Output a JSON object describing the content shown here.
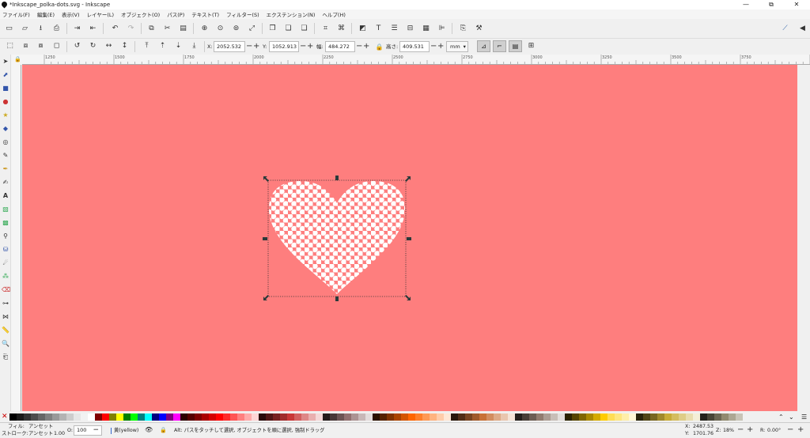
{
  "window": {
    "title": "*Inkscape_polka-dots.svg - Inkscape",
    "minimize": "—",
    "maximize": "⧉",
    "close": "✕"
  },
  "menu": [
    "ファイル(F)",
    "編集(E)",
    "表示(V)",
    "レイヤー(L)",
    "オブジェクト(O)",
    "パス(P)",
    "テキスト(T)",
    "フィルター(S)",
    "エクステンション(N)",
    "ヘルプ(H)"
  ],
  "selector_toolbar": {
    "x_label": "X:",
    "x_value": "2052.532",
    "y_label": "Y:",
    "y_value": "1052.913",
    "w_label": "幅:",
    "w_value": "484.272",
    "h_label": "高さ:",
    "h_value": "409.531",
    "unit": "mm"
  },
  "ruler": {
    "labels": [
      "1250",
      "1500",
      "1750",
      "2000",
      "2250",
      "2500",
      "2750",
      "3000",
      "3250",
      "3500",
      "3750"
    ]
  },
  "status": {
    "fill_label": "フィル:",
    "fill_value": "アンセット",
    "stroke_label": "ストローク:",
    "stroke_value": "アンセット",
    "stroke_width": "1.00",
    "opacity_label": "O:",
    "opacity_value": "100",
    "layer": "黄(yellow)",
    "message": "Alt: パスをタッチして選択, オブジェクトを順に選択, 強制ドラッグ",
    "x_label": "X:",
    "x_value": "2487.53",
    "y_label": "Y:",
    "y_value": "1701.76",
    "zoom_label": "Z:",
    "zoom_value": "18%",
    "rotate_label": "R:",
    "rotate_value": "0.00°"
  },
  "colors": {
    "canvas": "#fe7e7e",
    "heart_fill": "#ffffff"
  },
  "palette_colors": [
    "#000000",
    "#1a1a1a",
    "#333333",
    "#4d4d4d",
    "#666666",
    "#808080",
    "#999999",
    "#b3b3b3",
    "#cccccc",
    "#e6e6e6",
    "#f2f2f2",
    "#ffffff",
    "#800000",
    "#ff0000",
    "#808000",
    "#ffff00",
    "#008000",
    "#00ff00",
    "#008080",
    "#00ffff",
    "#000080",
    "#0000ff",
    "#800080",
    "#ff00ff",
    "#2b0000",
    "#550000",
    "#800000",
    "#aa0000",
    "#d40000",
    "#ff0000",
    "#ff2a2a",
    "#ff5555",
    "#ff8080",
    "#ffaaaa",
    "#ffd5d5",
    "#280b0b",
    "#501616",
    "#782121",
    "#a02c2c",
    "#c83737",
    "#d35f5f",
    "#de8787",
    "#e9afaf",
    "#f4d7d7",
    "#241c1c",
    "#483737",
    "#6c5353",
    "#916f6f",
    "#ac9393",
    "#c8b7b7",
    "#e3dbdb",
    "#2b1100",
    "#552200",
    "#803300",
    "#aa4400",
    "#d45500",
    "#ff6600",
    "#ff7f2a",
    "#ff9955",
    "#ffb380",
    "#ffccaa",
    "#ffe6d5",
    "#28170b",
    "#502d16",
    "#784421",
    "#a05a2c",
    "#c87137",
    "#d38d5f",
    "#deaa87",
    "#e9c6af",
    "#f4e3d7",
    "#241f1c",
    "#483e37",
    "#6c5d53",
    "#917c6f",
    "#ac9d93",
    "#c8beb7",
    "#e3dedb",
    "#2b2200",
    "#554400",
    "#806600",
    "#aa8800",
    "#d4aa00",
    "#ffcc00",
    "#ffdd55",
    "#ffe680",
    "#ffeeaa",
    "#fff6d5",
    "#28220b",
    "#504416",
    "#786721",
    "#a0892c",
    "#c8ab37",
    "#d4bd5f",
    "#decd87",
    "#e9ddaf",
    "#f4eed7",
    "#24221c",
    "#484537",
    "#6c6753",
    "#918a6f",
    "#aca793",
    "#c8c4b7"
  ]
}
